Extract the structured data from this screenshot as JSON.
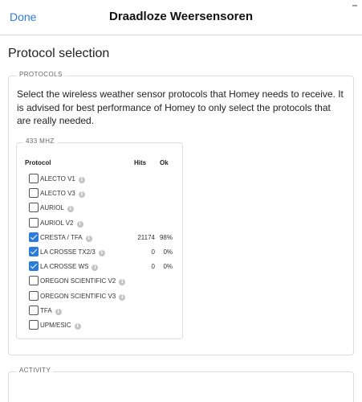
{
  "header": {
    "done_label": "Done",
    "title": "Draadloze Weersensoren"
  },
  "page": {
    "heading": "Protocol selection"
  },
  "protocols_section": {
    "legend": "PROTOCOLS",
    "description": "Select the wireless weather sensor protocols that Homey needs to receive. It is advised for best performance of Homey to only select the protocols that are really needed.",
    "group": {
      "legend": "433 MHZ",
      "columns": {
        "protocol": "Protocol",
        "hits": "Hits",
        "ok": "Ok"
      },
      "rows": [
        {
          "name": "ALECTO V1",
          "checked": false,
          "hits": "",
          "ok": ""
        },
        {
          "name": "ALECTO V3",
          "checked": false,
          "hits": "",
          "ok": ""
        },
        {
          "name": "AURIOL",
          "checked": false,
          "hits": "",
          "ok": ""
        },
        {
          "name": "AURIOL V2",
          "checked": false,
          "hits": "",
          "ok": ""
        },
        {
          "name": "CRESTA / TFA",
          "checked": true,
          "hits": "21174",
          "ok": "98%"
        },
        {
          "name": "LA CROSSE TX2/3",
          "checked": true,
          "hits": "0",
          "ok": "0%"
        },
        {
          "name": "LA CROSSE WS",
          "checked": true,
          "hits": "0",
          "ok": "0%"
        },
        {
          "name": "OREGON SCIENTIFIC V2",
          "checked": false,
          "hits": "",
          "ok": ""
        },
        {
          "name": "OREGON SCIENTIFIC V3",
          "checked": false,
          "hits": "",
          "ok": ""
        },
        {
          "name": "TFA",
          "checked": false,
          "hits": "",
          "ok": ""
        },
        {
          "name": "UPM/ESIC",
          "checked": false,
          "hits": "",
          "ok": ""
        }
      ]
    }
  },
  "activity_section": {
    "legend": "ACTIVITY"
  },
  "colors": {
    "accent": "#2b7bd9",
    "border": "#dedee2"
  }
}
